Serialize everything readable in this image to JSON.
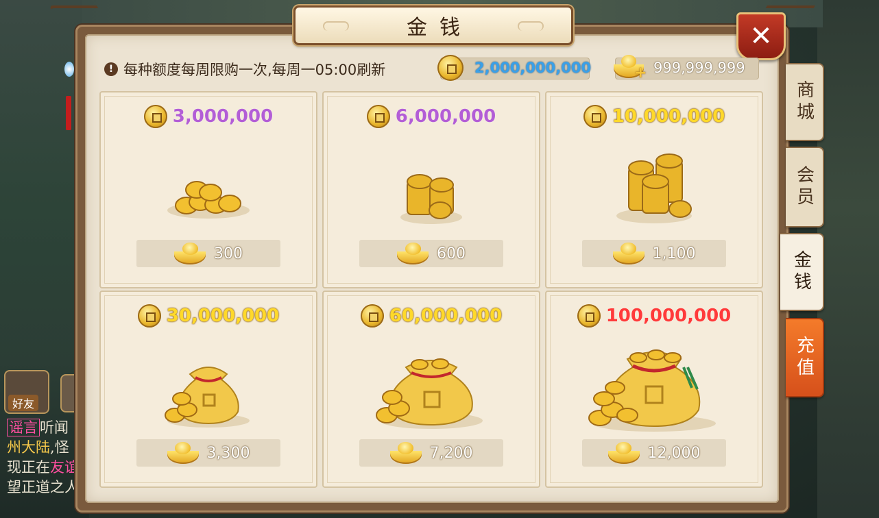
{
  "title": "金钱",
  "close_label": "✕",
  "notice": "每种额度每周限购一次,每周一05:00刷新",
  "currency": {
    "coins": "2,000,000,000",
    "ingots": "999,999,999",
    "coin_icon": "copper-coin-icon",
    "ingot_icon": "gold-ingot-plus-icon"
  },
  "side_tabs": [
    {
      "label": "商城",
      "active": false
    },
    {
      "label": "会员",
      "active": false
    },
    {
      "label": "金钱",
      "active": true
    },
    {
      "label": "充值",
      "active": false
    }
  ],
  "packages": [
    {
      "amount": "3,000,000",
      "price": "300",
      "color": "#b35ed6",
      "art": "small-coin-pile"
    },
    {
      "amount": "6,000,000",
      "price": "600",
      "color": "#b35ed6",
      "art": "coin-stack"
    },
    {
      "amount": "10,000,000",
      "price": "1,100",
      "color": "#ffd92a",
      "art": "large-coin-stacks"
    },
    {
      "amount": "30,000,000",
      "price": "3,300",
      "color": "#ffd92a",
      "art": "small-money-bag"
    },
    {
      "amount": "60,000,000",
      "price": "7,200",
      "color": "#ffd92a",
      "art": "medium-money-bag"
    },
    {
      "amount": "100,000,000",
      "price": "12,000",
      "color": "#ff3a3a",
      "art": "large-money-bag"
    }
  ],
  "left_overlay": {
    "friend_label": "好友",
    "chat_lines": [
      {
        "tag": "谣言",
        "text": "听闻"
      },
      {
        "text_yellow": "州大陆",
        "text": ",怪"
      },
      {
        "text": "现正在",
        "text_pink": "友谊"
      },
      {
        "text": "望正道之人"
      }
    ]
  }
}
